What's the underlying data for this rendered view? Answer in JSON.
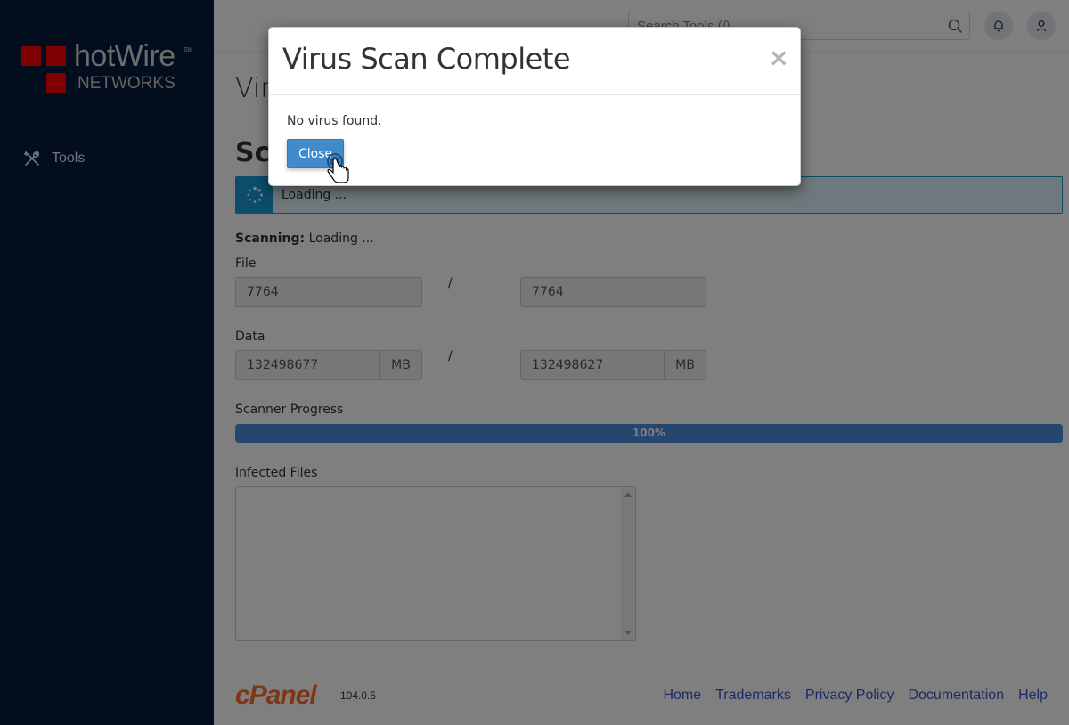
{
  "sidebar": {
    "logo": {
      "brand": "hotWire",
      "trademark": "SM",
      "subtitle": "NETWORKS",
      "accent_color": "#ff0000"
    },
    "nav_items": [
      {
        "label": "Tools",
        "icon": "tools-icon"
      }
    ]
  },
  "topbar": {
    "search": {
      "placeholder": "Search Tools (/)",
      "value": ""
    },
    "buttons": [
      {
        "name": "notifications",
        "icon": "bell-icon"
      },
      {
        "name": "user",
        "icon": "user-icon"
      }
    ]
  },
  "main": {
    "page_title_visible": "Vir",
    "section_title_visible": "Sca",
    "loading_alert": {
      "text": "Loading ...",
      "color": "#179bd7"
    },
    "scanning": {
      "label": "Scanning:",
      "value": "Loading ..."
    },
    "file": {
      "label": "File",
      "scanned": "7764",
      "separator": "/",
      "total": "7764"
    },
    "data": {
      "label": "Data",
      "scanned": "132498677",
      "scanned_unit": "MB",
      "separator": "/",
      "total": "132498627",
      "total_unit": "MB"
    },
    "scanner_progress": {
      "label": "Scanner Progress",
      "percent": 100,
      "text": "100%"
    },
    "infected_files": {
      "label": "Infected Files",
      "value": ""
    }
  },
  "footer": {
    "logo": "cPanel",
    "version": "104.0.5",
    "links": [
      "Home",
      "Trademarks",
      "Privacy Policy",
      "Documentation",
      "Help"
    ]
  },
  "modal": {
    "title": "Virus Scan Complete",
    "close_symbol": "×",
    "message": "No virus found.",
    "close_button": "Close"
  }
}
